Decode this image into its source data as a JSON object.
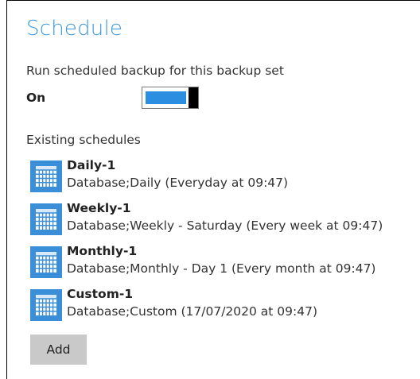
{
  "section": {
    "title": "Schedule"
  },
  "scheduled_backup": {
    "label": "Run scheduled backup for this backup set",
    "state_label": "On",
    "enabled": true
  },
  "existing": {
    "label": "Existing schedules",
    "items": [
      {
        "name": "Daily-1",
        "description": "Database;Daily (Everyday at 09:47)",
        "icon": "calendar-icon"
      },
      {
        "name": "Weekly-1",
        "description": "Database;Weekly - Saturday (Every week at 09:47)",
        "icon": "calendar-icon"
      },
      {
        "name": "Monthly-1",
        "description": "Database;Monthly - Day 1 (Every month at 09:47)",
        "icon": "calendar-icon"
      },
      {
        "name": "Custom-1",
        "description": "Database;Custom (17/07/2020 at 09:47)",
        "icon": "calendar-icon"
      }
    ]
  },
  "actions": {
    "add_label": "Add"
  },
  "colors": {
    "accent": "#3b98e0",
    "toggle_on": "#2b8ee0",
    "icon_bg": "#3b8ed8",
    "button_bg": "#c9c9c9"
  }
}
